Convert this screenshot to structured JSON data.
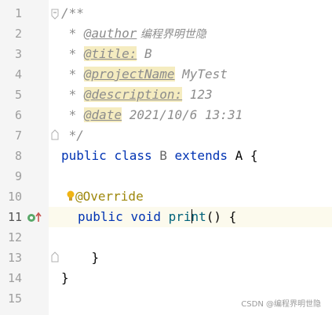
{
  "editor": {
    "line_numbers": [
      "1",
      "2",
      "3",
      "4",
      "5",
      "6",
      "7",
      "8",
      "9",
      "10",
      "11",
      "12",
      "13",
      "14",
      "15"
    ],
    "current_line": "11",
    "lines": {
      "l1": "/**",
      "l2_prefix": " * ",
      "l2_tag": "@author",
      "l2_value": " 编程界明世隐",
      "l3_prefix": " * ",
      "l3_tag": "@title:",
      "l3_value": " B",
      "l4_prefix": " * ",
      "l4_tag": "@projectName",
      "l4_value": " MyTest",
      "l5_prefix": " * ",
      "l5_tag": "@description:",
      "l5_value": " 123",
      "l6_prefix": " * ",
      "l6_tag": "@date",
      "l6_value": " 2021/10/6 13:31",
      "l7": " */",
      "l8_kw1": "public",
      "l8_kw2": "class",
      "l8_name": "B",
      "l8_kw3": "extends",
      "l8_super": "A {",
      "l10_annotation": "@Override",
      "l11_kw1": "public",
      "l11_kw2": "void",
      "l11_method_a": "pri",
      "l11_method_b": "nt",
      "l11_rest": "() {",
      "l13": "    }",
      "l14": "}"
    }
  },
  "watermark": "CSDN @编程界明世隐",
  "icons": {
    "intention": "lightbulb-icon",
    "override": "override-method-icon",
    "fold": "fold-marker-icon"
  },
  "colors": {
    "keyword": "#0033b3",
    "comment": "#8c8c8c",
    "annotation": "#9e880d",
    "doc_tag_bg": "#f5ecc0",
    "current_line_bg": "#fcfaed",
    "gutter_bg": "#f5f5f5"
  }
}
